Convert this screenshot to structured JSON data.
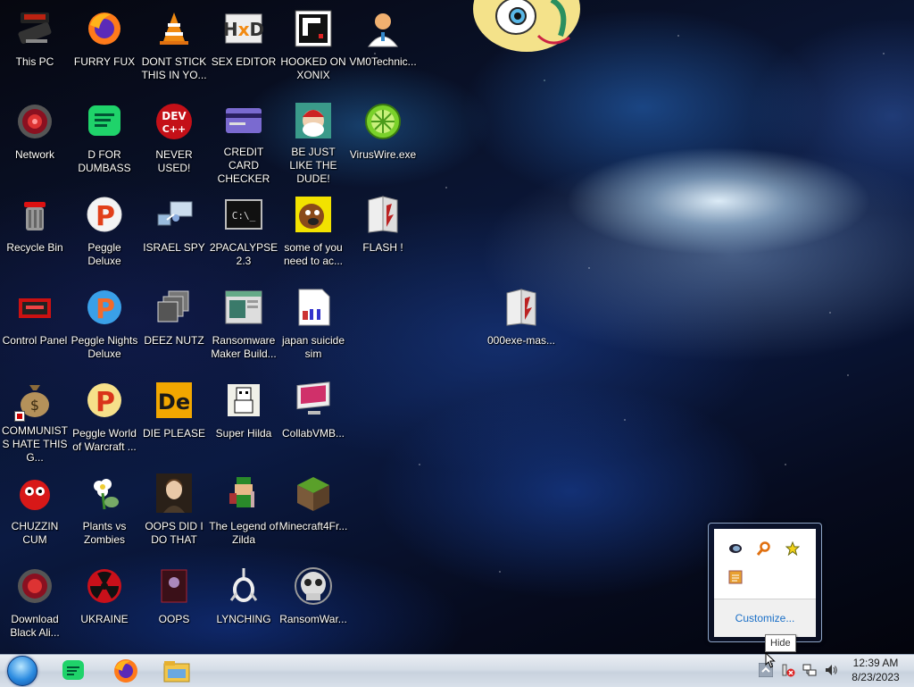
{
  "desktop": {
    "icons": [
      {
        "label": "This PC"
      },
      {
        "label": "Network"
      },
      {
        "label": "Recycle Bin"
      },
      {
        "label": "Control Panel"
      },
      {
        "label": "COMMUNISTS HATE THIS G..."
      },
      {
        "label": "CHUZZIN CUM"
      },
      {
        "label": "Download Black Ali..."
      },
      {
        "label": "FURRY FUX"
      },
      {
        "label": "D FOR DUMBASS"
      },
      {
        "label": "Peggle Deluxe"
      },
      {
        "label": "Peggle Nights Deluxe"
      },
      {
        "label": "Peggle World of Warcraft ..."
      },
      {
        "label": "Plants vs Zombies"
      },
      {
        "label": "UKRAINE"
      },
      {
        "label": "DONT STICK THIS IN YO..."
      },
      {
        "label": "NEVER USED!"
      },
      {
        "label": "ISRAEL SPY"
      },
      {
        "label": "DEEZ NUTZ"
      },
      {
        "label": "DIE PLEASE"
      },
      {
        "label": "OOPS DID I DO THAT"
      },
      {
        "label": "OOPS"
      },
      {
        "label": "SEX EDITOR"
      },
      {
        "label": "CREDIT CARD CHECKER"
      },
      {
        "label": "2PACALYPSE 2.3"
      },
      {
        "label": "Ransomware Maker Build..."
      },
      {
        "label": "Super Hilda"
      },
      {
        "label": "The Legend of Zilda"
      },
      {
        "label": "LYNCHING"
      },
      {
        "label": "HOOKED ON XONIX"
      },
      {
        "label": "BE JUST LIKE THE DUDE!"
      },
      {
        "label": "some of you need to ac..."
      },
      {
        "label": "japan suicide sim"
      },
      {
        "label": "CollabVMB..."
      },
      {
        "label": "Minecraft4Fr..."
      },
      {
        "label": "RansomWar..."
      },
      {
        "label": "VM0Technic..."
      },
      {
        "label": "VirusWire.exe"
      },
      {
        "label": "FLASH !"
      },
      {
        "label": "000exe-mas..."
      }
    ]
  },
  "tray_popup": {
    "customize_label": "Customize...",
    "icons": [
      "blue-orb-icon",
      "magnifier-icon",
      "star-icon",
      "notepad-icon"
    ]
  },
  "tooltip": {
    "text": "Hide"
  },
  "taskbar": {
    "pinned": [
      "d-for-dumbass-icon",
      "firefox-icon",
      "file-explorer-icon"
    ],
    "clock": {
      "time": "12:39 AM",
      "date": "8/23/2023"
    }
  },
  "colors": {
    "link": "#1a6fc7",
    "taskbar": "#d5dde7"
  }
}
